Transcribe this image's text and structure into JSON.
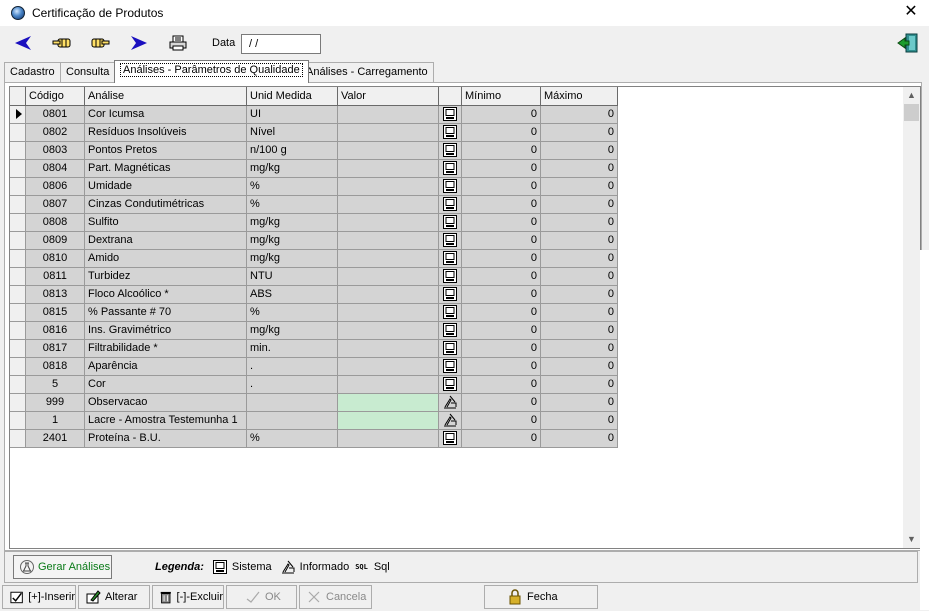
{
  "window": {
    "title": "Certificação de Produtos",
    "close_glyph": "✕"
  },
  "toolbar": {
    "date_label": "Data",
    "date_value": " / /",
    "icons": [
      "back-arrow-icon",
      "hand-left-icon",
      "hand-right-icon",
      "forward-arrow-icon",
      "printer-icon",
      "exit-door-icon"
    ]
  },
  "tabs": [
    {
      "label": "Cadastro"
    },
    {
      "label": "Consulta"
    },
    {
      "label": "Análises - Parâmetros de Qualidade"
    },
    {
      "label": "Análises - Carregamento"
    }
  ],
  "active_tab": 2,
  "grid": {
    "columns": {
      "codigo": "Código",
      "analise": "Análise",
      "unid": "Unid Medida",
      "valor": "Valor",
      "btn": "",
      "minimo": "Mínimo",
      "maximo": "Máximo"
    },
    "rows": [
      {
        "codigo": "0801",
        "analise": "Cor Icumsa",
        "unid": "UI",
        "valor": "",
        "mode": "sistema",
        "minimo": "0",
        "maximo": "0",
        "current": true
      },
      {
        "codigo": "0802",
        "analise": "Resíduos Insolúveis",
        "unid": "Nível",
        "valor": "",
        "mode": "sistema",
        "minimo": "0",
        "maximo": "0"
      },
      {
        "codigo": "0803",
        "analise": "Pontos Pretos",
        "unid": "n/100 g",
        "valor": "",
        "mode": "sistema",
        "minimo": "0",
        "maximo": "0"
      },
      {
        "codigo": "0804",
        "analise": "Part. Magnéticas",
        "unid": "mg/kg",
        "valor": "",
        "mode": "sistema",
        "minimo": "0",
        "maximo": "0"
      },
      {
        "codigo": "0806",
        "analise": "Umidade",
        "unid": "%",
        "valor": "",
        "mode": "sistema",
        "minimo": "0",
        "maximo": "0"
      },
      {
        "codigo": "0807",
        "analise": "Cinzas Condutimétricas",
        "unid": "%",
        "valor": "",
        "mode": "sistema",
        "minimo": "0",
        "maximo": "0"
      },
      {
        "codigo": "0808",
        "analise": "Sulfito",
        "unid": "mg/kg",
        "valor": "",
        "mode": "sistema",
        "minimo": "0",
        "maximo": "0"
      },
      {
        "codigo": "0809",
        "analise": "Dextrana",
        "unid": "mg/kg",
        "valor": "",
        "mode": "sistema",
        "minimo": "0",
        "maximo": "0"
      },
      {
        "codigo": "0810",
        "analise": "Amido",
        "unid": "mg/kg",
        "valor": "",
        "mode": "sistema",
        "minimo": "0",
        "maximo": "0"
      },
      {
        "codigo": "0811",
        "analise": "Turbidez",
        "unid": "NTU",
        "valor": "",
        "mode": "sistema",
        "minimo": "0",
        "maximo": "0"
      },
      {
        "codigo": "0813",
        "analise": "Floco Alcoólico *",
        "unid": "ABS",
        "valor": "",
        "mode": "sistema",
        "minimo": "0",
        "maximo": "0"
      },
      {
        "codigo": "0815",
        "analise": "% Passante # 70",
        "unid": "%",
        "valor": "",
        "mode": "sistema",
        "minimo": "0",
        "maximo": "0"
      },
      {
        "codigo": "0816",
        "analise": "Ins. Gravimétrico",
        "unid": "mg/kg",
        "valor": "",
        "mode": "sistema",
        "minimo": "0",
        "maximo": "0"
      },
      {
        "codigo": "0817",
        "analise": "Filtrabilidade *",
        "unid": "min.",
        "valor": "",
        "mode": "sistema",
        "minimo": "0",
        "maximo": "0"
      },
      {
        "codigo": "0818",
        "analise": "Aparência",
        "unid": ".",
        "valor": "",
        "mode": "sistema",
        "minimo": "0",
        "maximo": "0"
      },
      {
        "codigo": "5",
        "analise": "Cor",
        "unid": ".",
        "valor": "",
        "mode": "sistema",
        "minimo": "0",
        "maximo": "0"
      },
      {
        "codigo": "999",
        "analise": "Observacao",
        "unid": "",
        "valor": "",
        "mode": "informado",
        "minimo": "0",
        "maximo": "0"
      },
      {
        "codigo": "1",
        "analise": "Lacre - Amostra Testemunha 1",
        "unid": "",
        "valor": "",
        "mode": "informado",
        "minimo": "0",
        "maximo": "0"
      },
      {
        "codigo": "2401",
        "analise": "Proteína - B.U.",
        "unid": "%",
        "valor": "",
        "mode": "sistema",
        "minimo": "0",
        "maximo": "0"
      }
    ]
  },
  "bottom": {
    "gerar_label": "Gerar Análises",
    "legend_title": "Legenda:",
    "legend_sistema": "Sistema",
    "legend_informado": "Informado",
    "legend_sql_icon": "SQL",
    "legend_sql": "Sql"
  },
  "actions": {
    "inserir": "[+]-Inserir",
    "alterar": "Alterar",
    "excluir": "[-]-Excluir",
    "ok": "OK",
    "cancela": "Cancela",
    "fecha": "Fecha"
  },
  "colors": {
    "grid_cell": "#d4d4d4",
    "editable_cell": "#c8ebd0",
    "accent_arrow": "#1a0fbf",
    "gerar_text": "#0a7a18"
  }
}
